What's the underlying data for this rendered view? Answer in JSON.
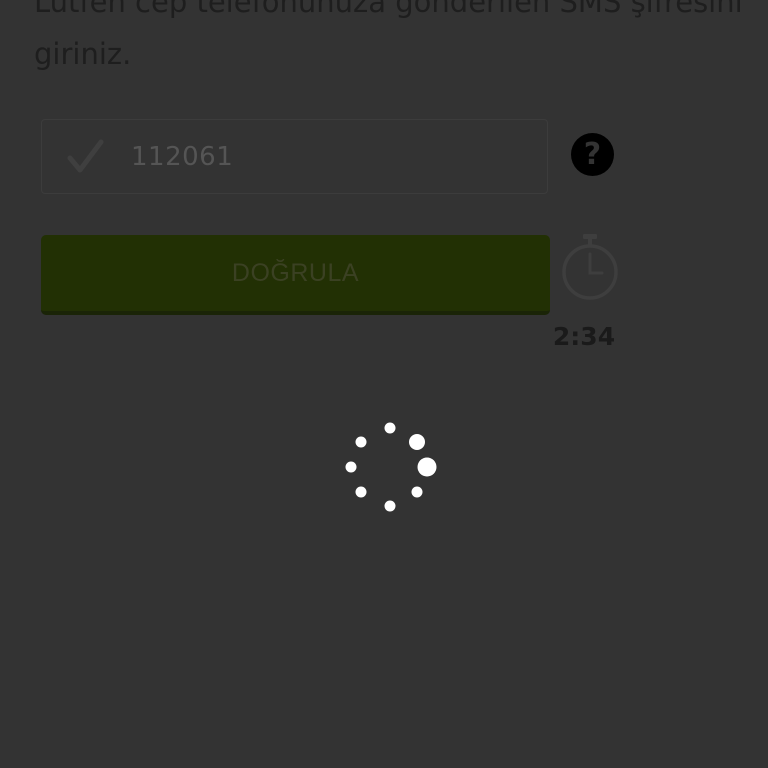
{
  "instruction": {
    "line1": "Lütfen cep telefonunuza gönderilen SMS şifresini",
    "line2": "giriniz."
  },
  "sms_code": {
    "value": "112061",
    "status_icon": "checkmark-icon"
  },
  "help": {
    "icon": "question-circle-icon",
    "glyph": "?"
  },
  "verify_button": {
    "label": "DOĞRULA",
    "color": "#223004"
  },
  "timer": {
    "icon": "stopwatch-icon",
    "remaining": "2:34"
  },
  "overlay": {
    "loading_spinner": "spinner-icon",
    "dim_color": "#333333"
  }
}
